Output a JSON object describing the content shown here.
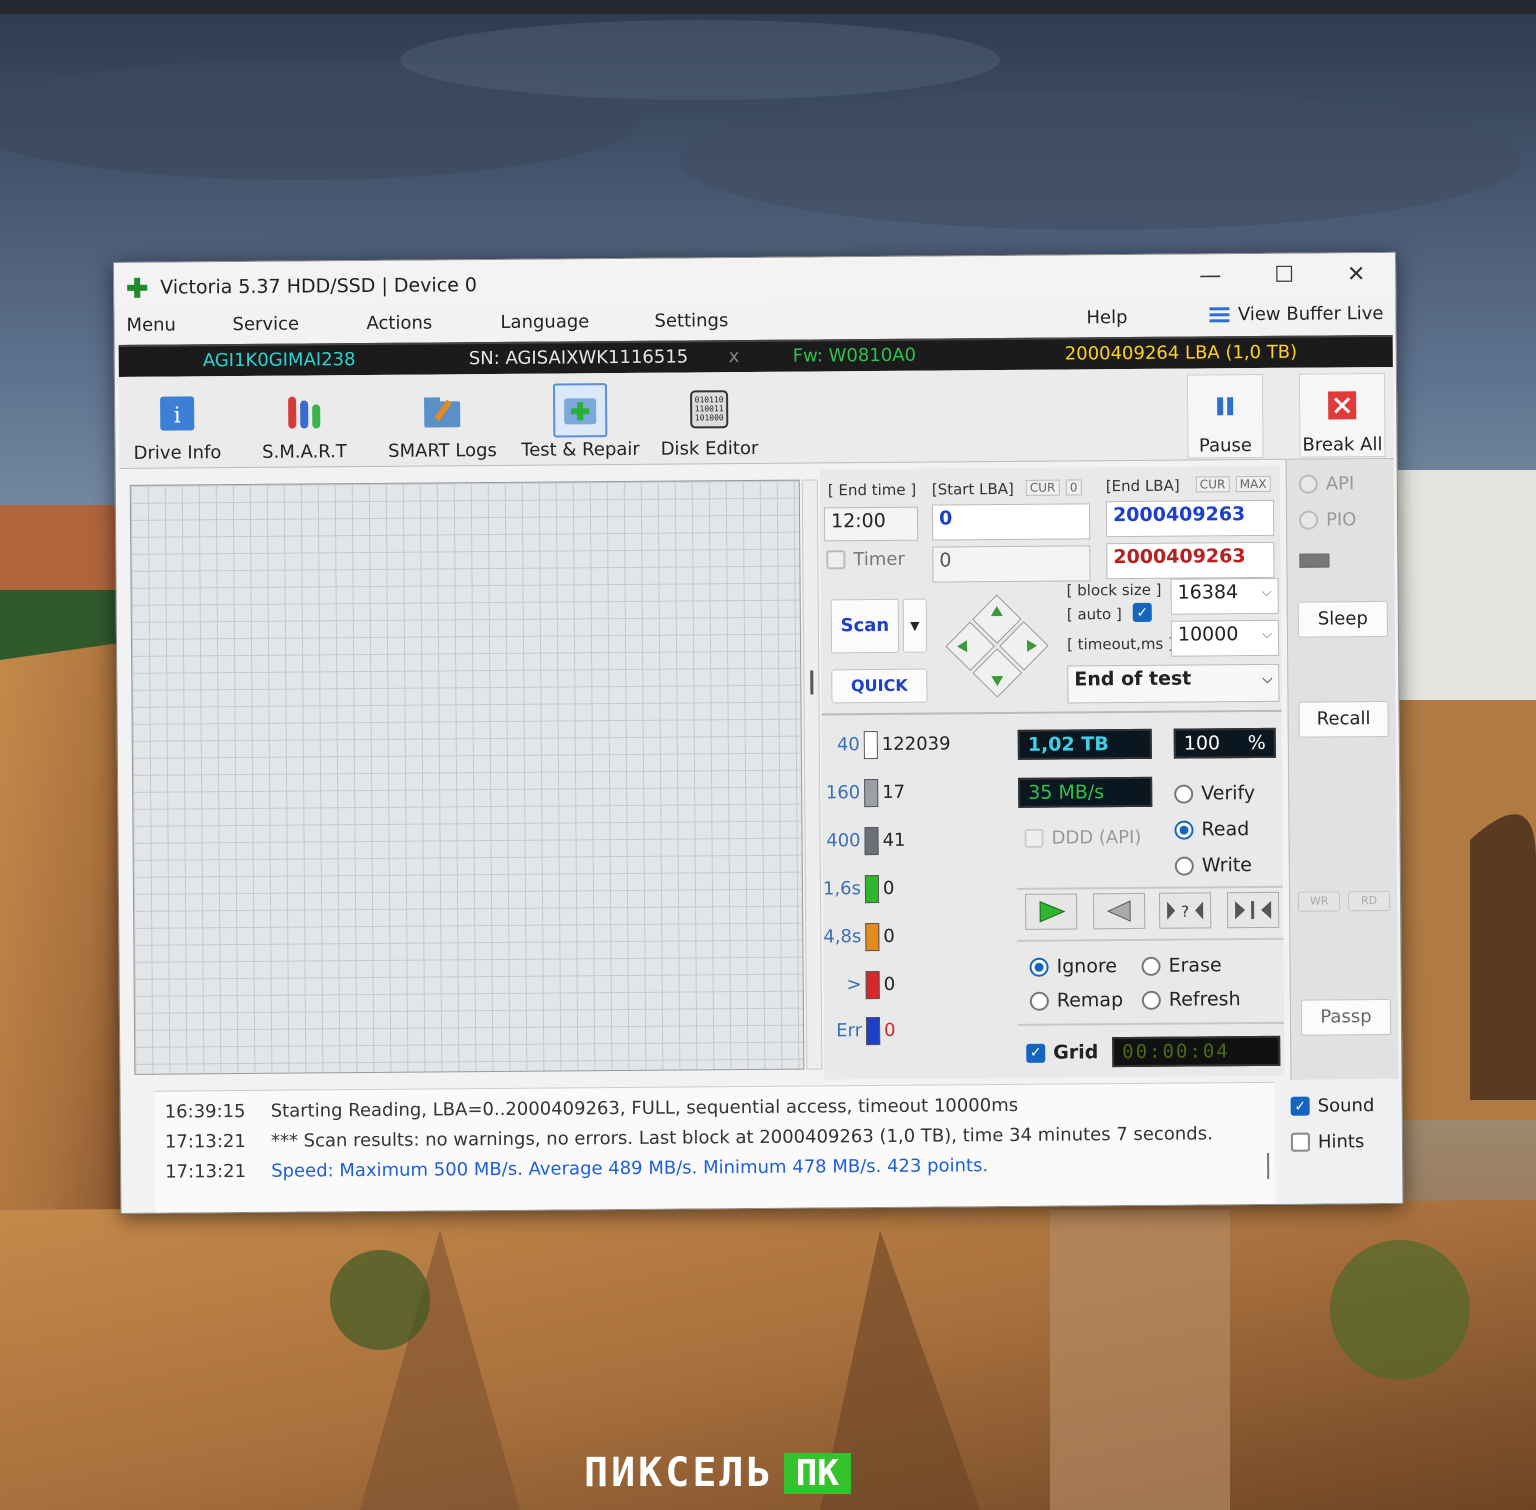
{
  "window": {
    "title": "Victoria 5.37 HDD/SSD | Device 0",
    "controls": {
      "minimize": "—",
      "maximize": "☐",
      "close": "✕"
    }
  },
  "menu": {
    "items": [
      "Menu",
      "Service",
      "Actions",
      "Language",
      "Settings",
      "Help"
    ],
    "view_buffer_live": "View Buffer Live"
  },
  "device_bar": {
    "model": "AGI1K0GIMAI238",
    "serial": "SN: AGISAIXWK1116515",
    "close": "x",
    "firmware": "Fw: W0810A0",
    "capacity": "2000409264 LBA (1,0 TB)"
  },
  "toolbar": {
    "drive_info": "Drive Info",
    "smart": "S.M.A.R.T",
    "smart_logs": "SMART Logs",
    "test_repair": "Test & Repair",
    "disk_editor": "Disk Editor",
    "pause": "Pause",
    "break_all": "Break All"
  },
  "scan": {
    "end_time_label": "[ End time ]",
    "end_time_value": "12:00",
    "timer_label": "Timer",
    "start_lba_label": "[Start LBA]",
    "cur": "CUR",
    "start_zero_btn": "0",
    "end_lba_label": "[End LBA]",
    "max": "MAX",
    "start_lba": "0",
    "start_lba_cur": "0",
    "end_lba": "2000409263",
    "end_lba_cur": "2000409263",
    "scan_button": "Scan",
    "quick_button": "QUICK",
    "block_size_label": "[ block size ]",
    "auto_label": "[ auto ]",
    "block_size": "16384",
    "timeout_label": "[ timeout,ms ]",
    "timeout": "10000",
    "end_action": "End of test"
  },
  "counters": [
    {
      "key": "40",
      "value": "122039",
      "color": "#ffffff"
    },
    {
      "key": "160",
      "value": "17",
      "color": "#9aa0a6"
    },
    {
      "key": "400",
      "value": "41",
      "color": "#6b7078"
    },
    {
      "key": "1,6s",
      "value": "0",
      "color": "#2fb52f"
    },
    {
      "key": "4,8s",
      "value": "0",
      "color": "#e58a1e"
    },
    {
      "key": ">",
      "value": "0",
      "color": "#d62828"
    },
    {
      "key": "Err",
      "value": "0",
      "color": "#1e40c8"
    }
  ],
  "status": {
    "size_done": "1,02 TB",
    "percent": "100",
    "percent_sign": "%",
    "speed": "35 MB/s",
    "ddd_label": "DDD (API)",
    "timer_display": "00:00:04"
  },
  "mode": {
    "options": [
      "Verify",
      "Read",
      "Write"
    ],
    "selected": "Read"
  },
  "repair": {
    "options": [
      "Ignore",
      "Erase",
      "Remap",
      "Refresh"
    ],
    "selected": "Ignore"
  },
  "grid_label": "Grid",
  "sidebar": {
    "api": "API",
    "pio": "PIO",
    "sleep": "Sleep",
    "recall": "Recall",
    "wr": "WR",
    "rd": "RD",
    "passp": "Passp"
  },
  "log": [
    {
      "time": "16:39:15",
      "msg": "Starting Reading, LBA=0..2000409263, FULL, sequential access, timeout 10000ms",
      "highlight": false
    },
    {
      "time": "17:13:21",
      "msg": "*** Scan results: no warnings, no errors. Last block at 2000409263 (1,0 TB), time 34 minutes 7 seconds.",
      "highlight": false
    },
    {
      "time": "17:13:21",
      "msg": "Speed: Maximum 500 MB/s. Average 489 MB/s. Minimum 478 MB/s. 423 points.",
      "highlight": true
    }
  ],
  "options": {
    "sound": "Sound",
    "hints": "Hints"
  },
  "watermark": {
    "part1": "ПИКСЕЛЬ",
    "part2": "ПК"
  }
}
